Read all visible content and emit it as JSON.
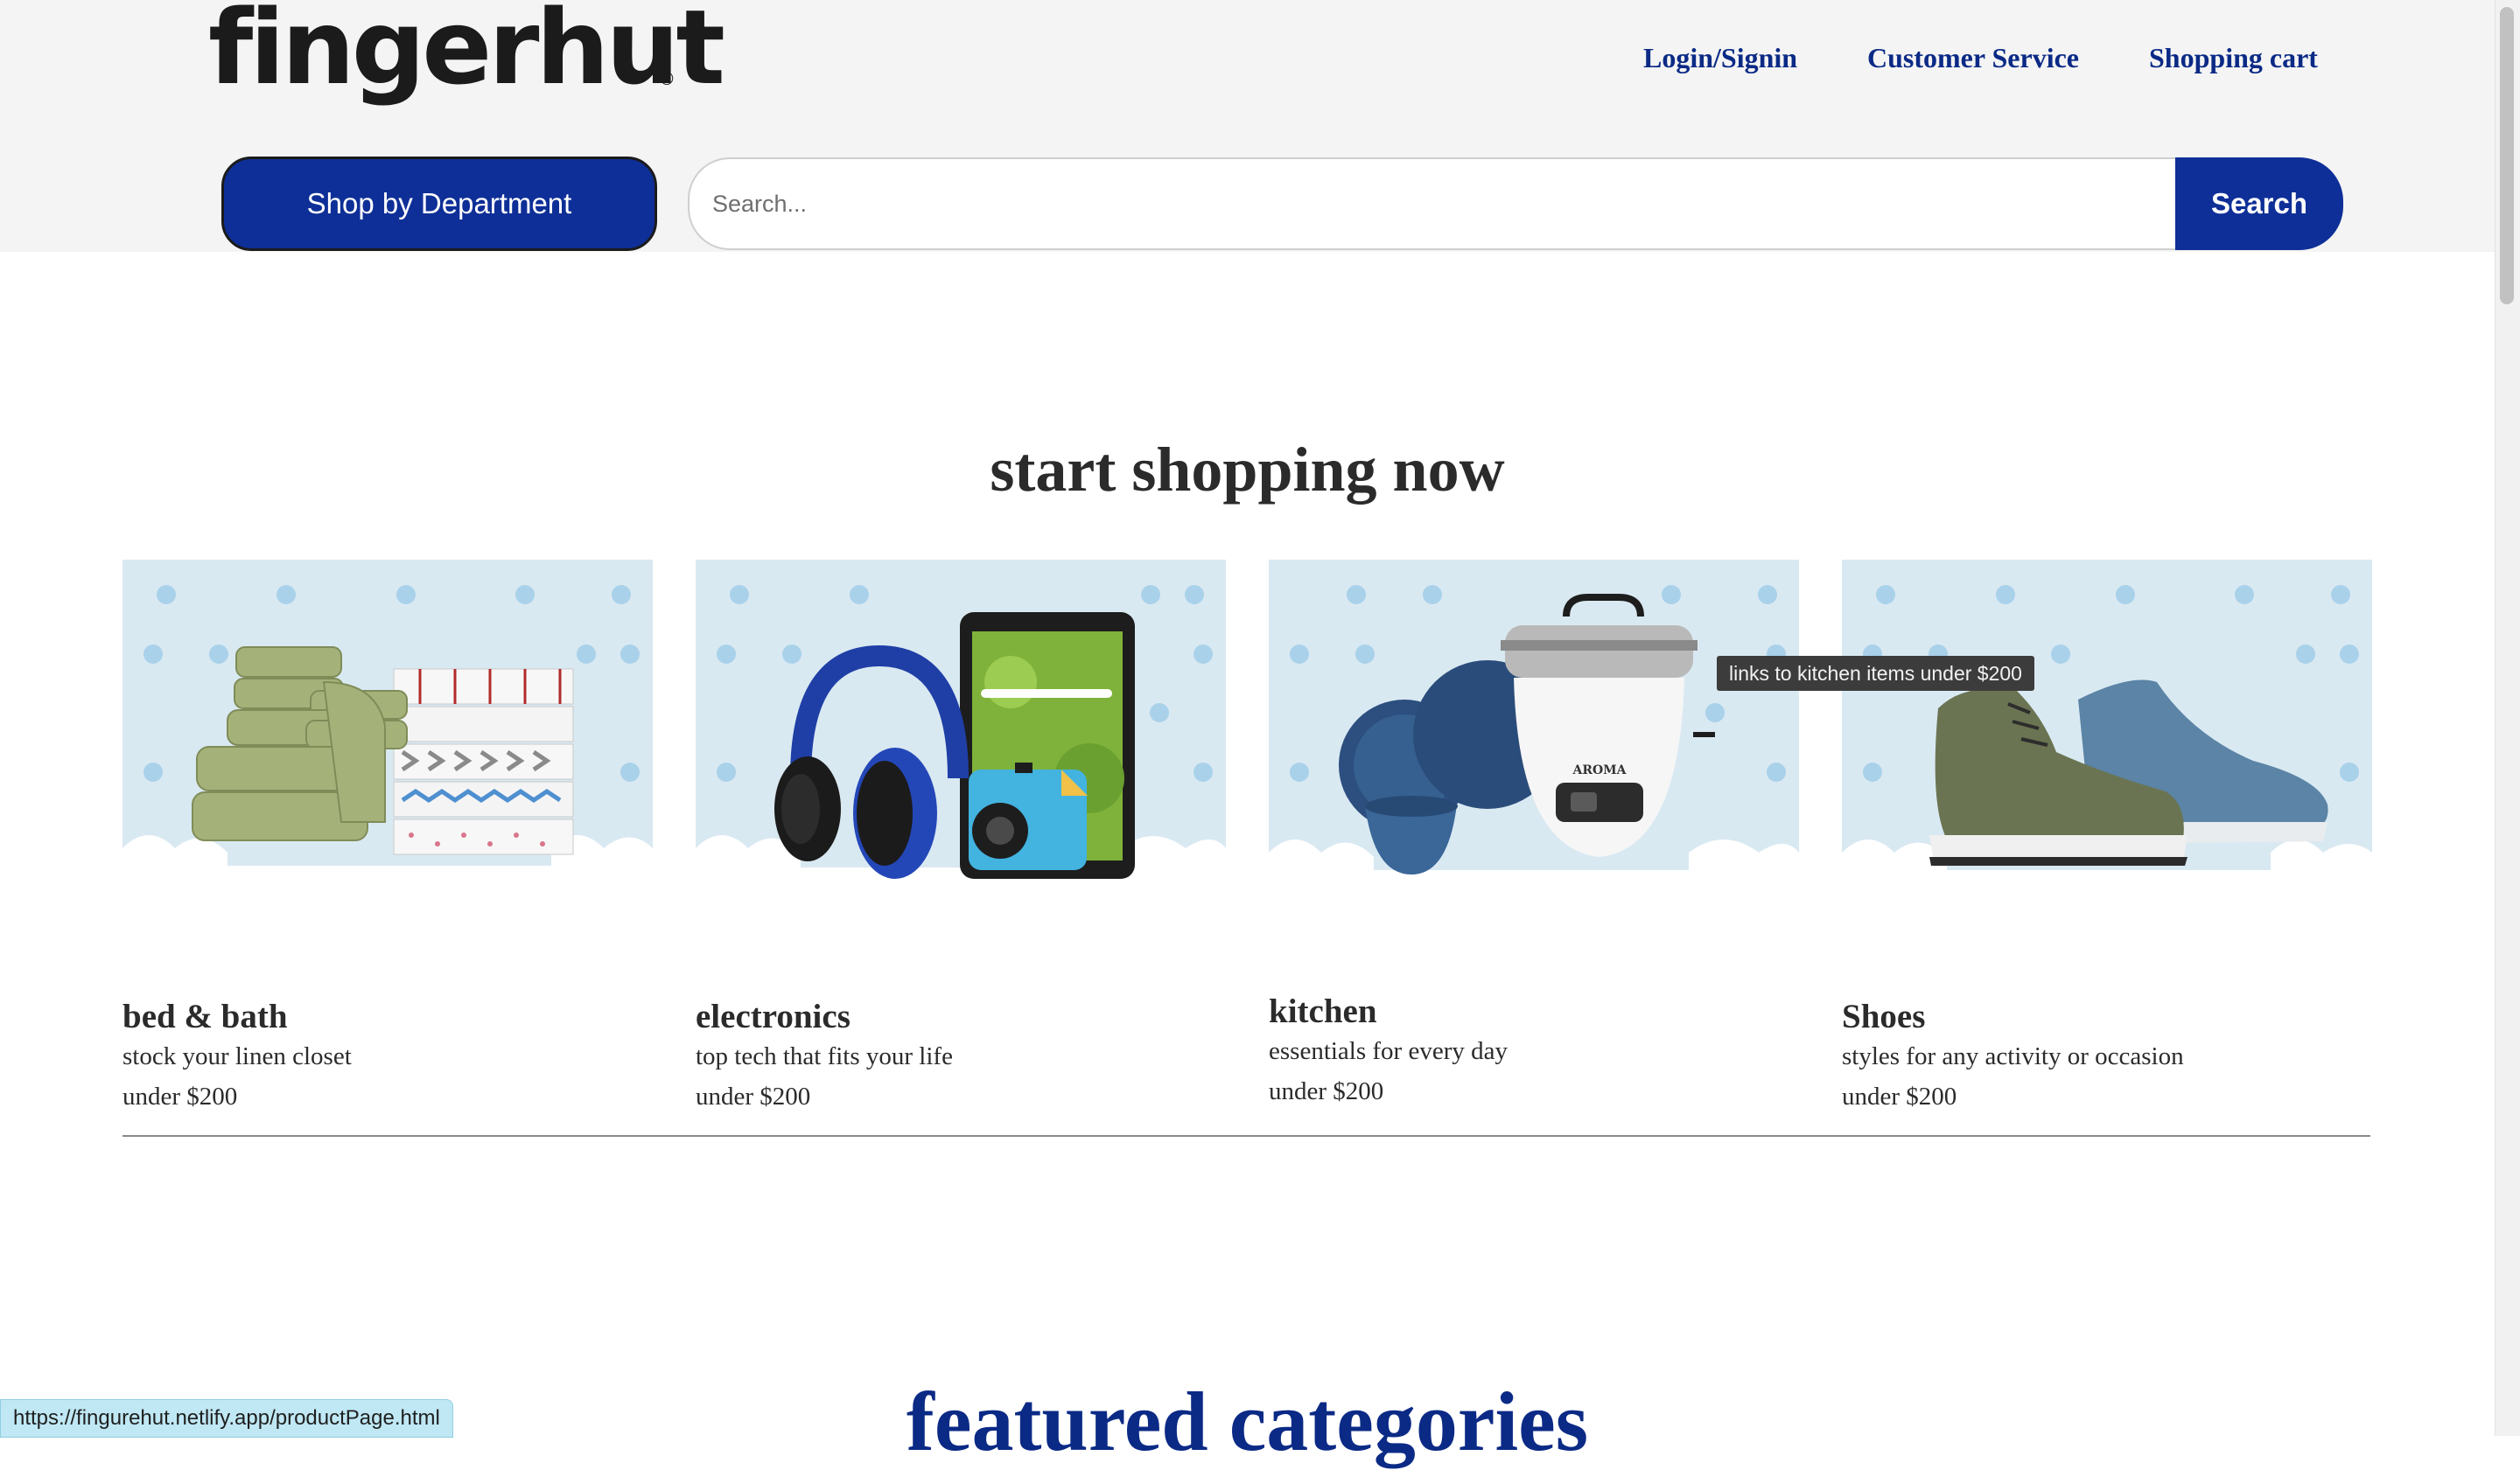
{
  "header": {
    "logo": "fingerhut",
    "logo_mark": "®",
    "nav": {
      "login": "Login/Signin",
      "customer_service": "Customer Service",
      "cart": "Shopping cart"
    },
    "department_button": "Shop by Department",
    "search": {
      "placeholder": "Search...",
      "value": "",
      "button": "Search"
    }
  },
  "main": {
    "section_title": "start shopping now",
    "cards": [
      {
        "title": "bed & bath",
        "subtitle": "stock your linen closet",
        "price": "under $200",
        "image_icon": "towels-and-sheets"
      },
      {
        "title": "electronics",
        "subtitle": "top tech that fits your life",
        "price": "under $200",
        "image_icon": "headphones-tablet-camera"
      },
      {
        "title": "kitchen",
        "subtitle": "essentials for every day",
        "price": "under $200",
        "image_icon": "rice-cooker-dishes",
        "appliance_brand": "AROMA"
      },
      {
        "title": "Shoes",
        "subtitle": "styles for any activity or occasion",
        "price": "under $200",
        "image_icon": "sneakers"
      }
    ],
    "tooltip": "links to kitchen items under $200",
    "featured_title": "featured categories"
  },
  "browser": {
    "status_url": "https://fingurehut.netlify.app/productPage.html"
  },
  "colors": {
    "brand_blue": "#0e2f97",
    "link_blue": "#0b2a86",
    "header_bg": "#f4f4f4",
    "card_bg": "#d9e9f2",
    "dot": "#a9d1ea"
  }
}
